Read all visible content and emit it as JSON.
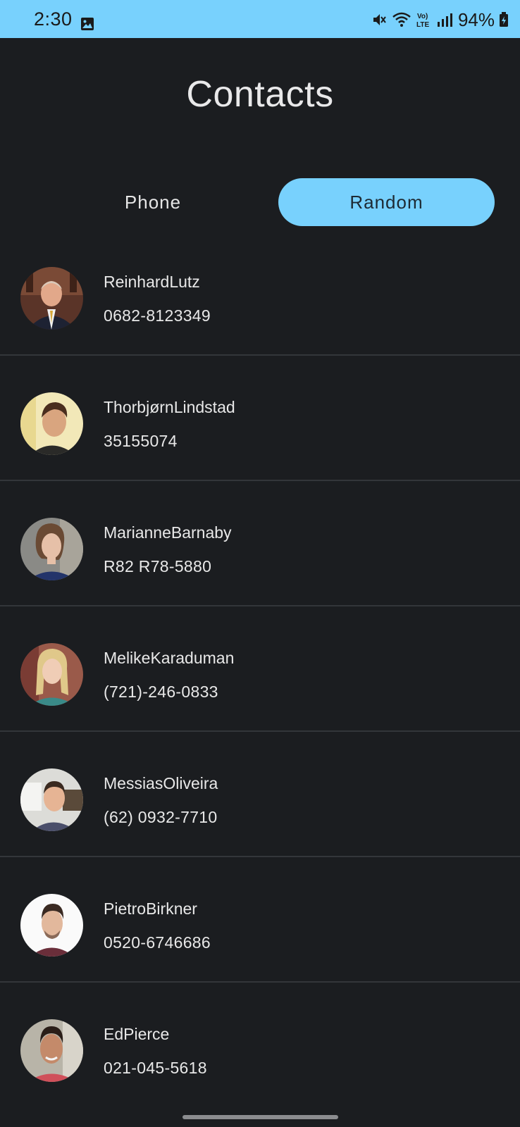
{
  "status_bar": {
    "time": "2:30",
    "battery": "94%",
    "icons": [
      "image-icon",
      "mute-icon",
      "wifi-icon",
      "volte-icon",
      "signal-icon",
      "battery-icon"
    ],
    "background": "#78d1fd"
  },
  "header": {
    "title": "Contacts"
  },
  "tabs": [
    {
      "label": "Phone",
      "selected": false
    },
    {
      "label": "Random",
      "selected": true
    }
  ],
  "accent_color": "#78d1fd",
  "contacts": [
    {
      "name": "ReinhardLutz",
      "phone": "0682-8123349",
      "avatar_icon": "avatar-photo"
    },
    {
      "name": "ThorbjørnLindstad",
      "phone": "35155074",
      "avatar_icon": "avatar-photo"
    },
    {
      "name": "MarianneBarnaby",
      "phone": "R82 R78-5880",
      "avatar_icon": "avatar-photo"
    },
    {
      "name": "MelikeKaraduman",
      "phone": "(721)-246-0833",
      "avatar_icon": "avatar-photo"
    },
    {
      "name": "MessiasOliveira",
      "phone": "(62) 0932-7710",
      "avatar_icon": "avatar-photo"
    },
    {
      "name": "PietroBirkner",
      "phone": "0520-6746686",
      "avatar_icon": "avatar-photo"
    },
    {
      "name": "EdPierce",
      "phone": "021-045-5618",
      "avatar_icon": "avatar-photo"
    }
  ]
}
